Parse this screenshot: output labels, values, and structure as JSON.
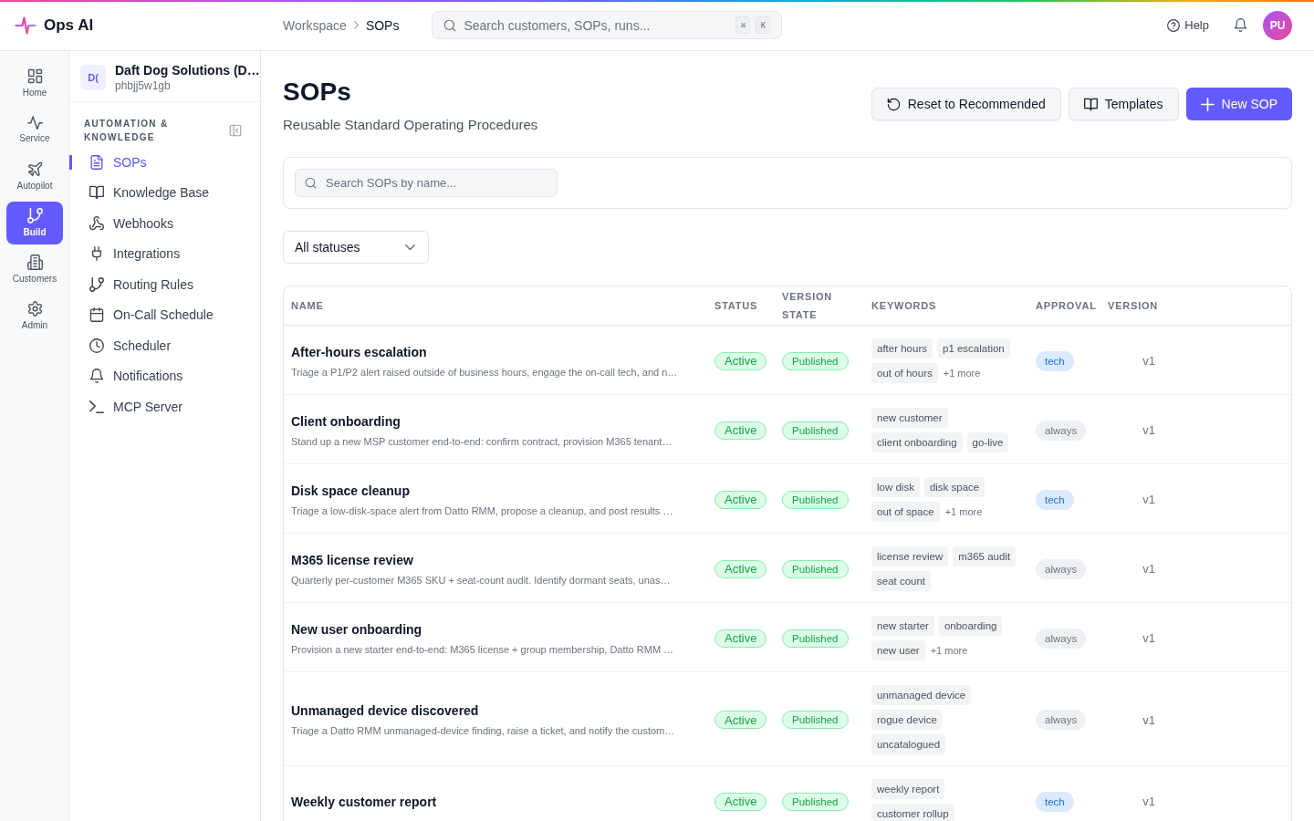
{
  "app": {
    "name": "Ops AI"
  },
  "breadcrumb": [
    {
      "label": "Workspace",
      "current": false
    },
    {
      "label": "SOPs",
      "current": true
    }
  ],
  "global_search": {
    "placeholder": "Search customers, SOPs, runs...",
    "shortcut": [
      "⌘",
      "K"
    ]
  },
  "help": {
    "label": "Help"
  },
  "user": {
    "initials": "PU"
  },
  "rail": [
    {
      "label": "Home",
      "selected": false
    },
    {
      "label": "Service",
      "selected": false
    },
    {
      "label": "Autopilot",
      "selected": false
    },
    {
      "label": "Build",
      "selected": true
    },
    {
      "label": "Customers",
      "selected": false
    },
    {
      "label": "Admin",
      "selected": false
    }
  ],
  "workspace": {
    "badge": "D(",
    "name": "Daft Dog Solutions (D…",
    "id": "phbjj5w1gb"
  },
  "sidebar": {
    "section_title": "AUTOMATION & KNOWLEDGE",
    "items": [
      {
        "label": "SOPs",
        "selected": true
      },
      {
        "label": "Knowledge Base",
        "selected": false
      },
      {
        "label": "Webhooks",
        "selected": false
      },
      {
        "label": "Integrations",
        "selected": false
      },
      {
        "label": "Routing Rules",
        "selected": false
      },
      {
        "label": "On-Call Schedule",
        "selected": false
      },
      {
        "label": "Scheduler",
        "selected": false
      },
      {
        "label": "Notifications",
        "selected": false
      },
      {
        "label": "MCP Server",
        "selected": false
      }
    ]
  },
  "page": {
    "title": "SOPs",
    "subtitle": "Reusable Standard Operating Procedures",
    "actions": [
      {
        "label": "Reset to Recommended",
        "kind": "secondary"
      },
      {
        "label": "Templates",
        "kind": "secondary"
      },
      {
        "label": "New SOP",
        "kind": "primary"
      }
    ]
  },
  "sop_search": {
    "placeholder": "Search SOPs by name..."
  },
  "status_filter": {
    "value": "All statuses"
  },
  "table": {
    "columns": [
      "NAME",
      "STATUS",
      "VERSION STATE",
      "KEYWORDS",
      "APPROVAL",
      "VERSION"
    ],
    "rows": [
      {
        "name": "After-hours escalation",
        "description": "Triage a P1/P2 alert raised outside of business hours, engage the on-call tech, and n…",
        "status": "Active",
        "version_state": "Published",
        "keywords": [
          "after hours",
          "p1 escalation",
          "out of hours"
        ],
        "more": "+1 more",
        "approval": {
          "label": "tech",
          "kind": "highlight"
        },
        "version": "v1"
      },
      {
        "name": "Client onboarding",
        "description": "Stand up a new MSP customer end-to-end: confirm contract, provision M365 tenant…",
        "status": "Active",
        "version_state": "Published",
        "keywords": [
          "new customer",
          "client onboarding",
          "go-live"
        ],
        "approval": {
          "label": "always",
          "kind": "plain"
        },
        "version": "v1"
      },
      {
        "name": "Disk space cleanup",
        "description": "Triage a low-disk-space alert from Datto RMM, propose a cleanup, and post results …",
        "status": "Active",
        "version_state": "Published",
        "keywords": [
          "low disk",
          "disk space",
          "out of space"
        ],
        "more": "+1 more",
        "approval": {
          "label": "tech",
          "kind": "highlight"
        },
        "version": "v1"
      },
      {
        "name": "M365 license review",
        "description": "Quarterly per-customer M365 SKU + seat-count audit. Identify dormant seats, unas…",
        "status": "Active",
        "version_state": "Published",
        "keywords": [
          "license review",
          "m365 audit",
          "seat count"
        ],
        "approval": {
          "label": "always",
          "kind": "plain"
        },
        "version": "v1"
      },
      {
        "name": "New user onboarding",
        "description": "Provision a new starter end-to-end: M365 license + group membership, Datto RMM …",
        "status": "Active",
        "version_state": "Published",
        "keywords": [
          "new starter",
          "onboarding",
          "new user"
        ],
        "more": "+1 more",
        "approval": {
          "label": "always",
          "kind": "plain"
        },
        "version": "v1"
      },
      {
        "name": "Unmanaged device discovered",
        "description": "Triage a Datto RMM unmanaged-device finding, raise a ticket, and notify the custom…",
        "status": "Active",
        "version_state": "Published",
        "keywords": [
          "unmanaged device",
          "rogue device",
          "uncatalogued"
        ],
        "approval": {
          "label": "always",
          "kind": "plain"
        },
        "version": "v1"
      },
      {
        "name": "Weekly customer report",
        "status": "Active",
        "version_state": "Published",
        "keywords": [
          "weekly report",
          "customer rollup"
        ],
        "approval": {
          "label": "tech",
          "kind": "highlight"
        },
        "version": "v1"
      }
    ]
  }
}
